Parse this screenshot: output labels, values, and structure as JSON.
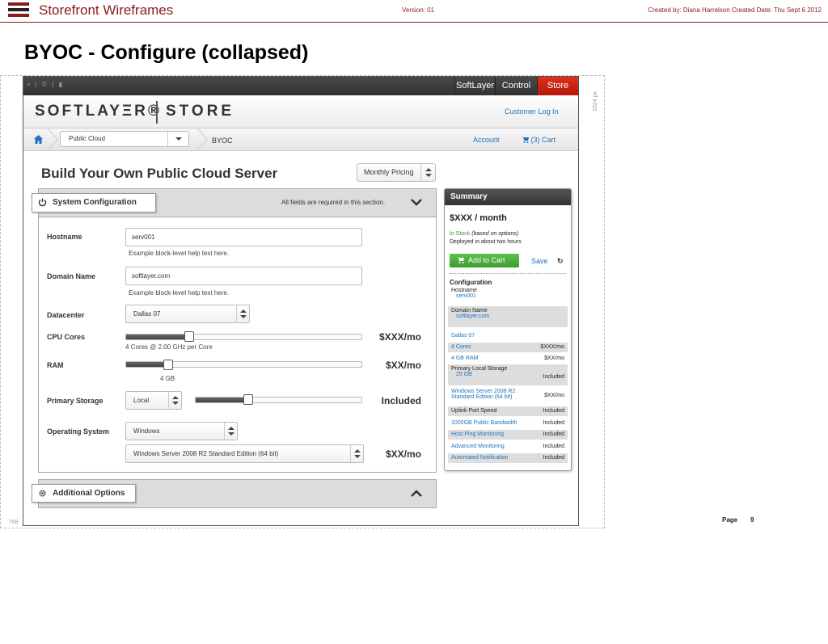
{
  "doc": {
    "title": "Storefront Wireframes",
    "version": "Version: 01",
    "created": "Created by: Diana Harrelson  Created Date: Thu Sept 6 2012",
    "heading": "BYOC - Configure (collapsed)",
    "dim_width": "1024 px",
    "dim_height": "768",
    "page_label": "Page",
    "page_number": "9"
  },
  "topbar": {
    "icons": "▪ | ✆ | ▮",
    "tabs": [
      "SoftLayer",
      "Control",
      "Store"
    ],
    "active_tab": "Store"
  },
  "brand": {
    "logo": "SOFTLAYΞR®",
    "store": "STORE",
    "login": "Customer Log In"
  },
  "breadcrumb": {
    "select_value": "Public Cloud",
    "current": "BYOC",
    "account": "Account",
    "cart": "(3) Cart"
  },
  "page": {
    "title": "Build Your Own Public Cloud Server",
    "pricing": "Monthly Pricing"
  },
  "config": {
    "header": "System Configuration",
    "required_note": "All fields are required in this section.",
    "hostname_label": "Hostname",
    "hostname_value": "serv001",
    "hostname_help": "Example block-level help text here.",
    "domain_label": "Domain Name",
    "domain_value": "softlayer.com",
    "domain_help": "Example block-level help text here.",
    "datacenter_label": "Datacenter",
    "datacenter_value": "Dallas 07",
    "cpu_label": "CPU Cores",
    "cpu_caption": "4 Cores @ 2.00 GHz per Core",
    "cpu_price": "$XXX/mo",
    "cpu_level": 0.27,
    "ram_label": "RAM",
    "ram_caption": "4 GB",
    "ram_price": "$XX/mo",
    "ram_level": 0.18,
    "storage_label": "Primary Storage",
    "storage_type": "Local",
    "storage_price": "Included",
    "storage_level": 0.32,
    "os_label": "Operating System",
    "os_value": "Windows",
    "os_edition": "Windows Server 2008 R2 Standard Edition (64 bit)",
    "os_price": "$XX/mo"
  },
  "options": {
    "header": "Additional Options"
  },
  "summary": {
    "header": "Summary",
    "price": "$XXX / month",
    "stock": "In Stock",
    "stock_note": "(based on options)",
    "deploy": "Deployed in about two hours",
    "add_to_cart": "Add to Cart",
    "save": "Save",
    "config_heading": "Configuration",
    "hostname_label": "Hostname",
    "hostname_value": "serv001",
    "domain_label": "Domain Name",
    "domain_value": "softlayer.com",
    "datacenter": "Dallas 07",
    "cores": "4 Cores",
    "cores_price": "$XXX/mo",
    "ram": "4 GB RAM",
    "ram_price": "$XX/mo",
    "storage_label": "Primary Local Storage",
    "storage_value": "25 GB",
    "storage_price": "Included",
    "os_line1": "Windows Server 2008 R2",
    "os_line2": "Standard Edition (64 bit)",
    "os_price": "$XX/mo",
    "uplink": "Uplink Port Speed",
    "uplink_price": "Included",
    "bandwidth": "1000GB Public Bandwidth",
    "bandwidth_price": "Included",
    "host_ping": "Host Ping Monitoring",
    "host_ping_price": "Included",
    "adv_monitoring": "Advanced Monitoring",
    "adv_monitoring_price": "Included",
    "auto_notification": "Automated Notification",
    "auto_notification_price": "Included"
  },
  "colors": {
    "doc_accent": "#8b1a1a",
    "store_tab": "#d42a16",
    "link": "#1e73be",
    "cart_button": "#4caf3e",
    "in_stock": "#3a9a2a"
  }
}
